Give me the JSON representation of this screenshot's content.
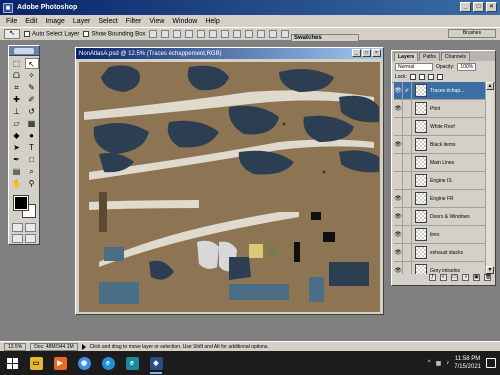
{
  "app": {
    "title": "Adobe Photoshop",
    "icon_name": "photoshop-icon",
    "window_controls": [
      "minimize",
      "maximize",
      "close"
    ]
  },
  "menu": [
    "File",
    "Edit",
    "Image",
    "Layer",
    "Select",
    "Filter",
    "View",
    "Window",
    "Help"
  ],
  "options": {
    "auto_select": "Auto Select Layer",
    "show_bounding": "Show Bounding Box"
  },
  "palette_tabs": {
    "swatches": "Swatches",
    "brushes": "Brushes"
  },
  "document": {
    "title": "NonAtlasA.psd @ 12.5% (Traces échappement,RGB)",
    "canvas_bg": "#8b7355"
  },
  "layers_panel": {
    "tabs": [
      "Layers",
      "Paths",
      "Channels"
    ],
    "blend_mode": "Normal",
    "opacity_label": "Opacity:",
    "opacity_value": "100%",
    "lock_label": "Lock:",
    "items": [
      {
        "name": "Traces échap...",
        "visible": true,
        "selected": true
      },
      {
        "name": "Pitot",
        "visible": true,
        "selected": false
      },
      {
        "name": "White Roof",
        "visible": false,
        "selected": false
      },
      {
        "name": "Black items",
        "visible": true,
        "selected": false
      },
      {
        "name": "Main Lines",
        "visible": false,
        "selected": false
      },
      {
        "name": "Engine IS",
        "visible": false,
        "selected": false
      },
      {
        "name": "Engine FR",
        "visible": true,
        "selected": false
      },
      {
        "name": "Doors & Windows",
        "visible": true,
        "selected": false
      },
      {
        "name": "tires",
        "visible": true,
        "selected": false
      },
      {
        "name": "exhaust stacks",
        "visible": true,
        "selected": false
      },
      {
        "name": "Grey intrados",
        "visible": true,
        "selected": false
      }
    ]
  },
  "status": {
    "zoom": "12.5%",
    "doc_info": "Doc: 48M/344.1M",
    "hint": "Click and drag to move layer or selection. Use Shift and Alt for additional options."
  },
  "taskbar": {
    "time": "11:58 PM",
    "date": "7/15/2021",
    "apps": [
      {
        "icon": "file-explorer-icon",
        "color": "#e8b830",
        "glyph": "▭"
      },
      {
        "icon": "media-player-icon",
        "color": "#e86a20",
        "glyph": "▶"
      },
      {
        "icon": "chrome-icon",
        "color": "#3a8ee6",
        "glyph": "◉"
      },
      {
        "icon": "edge-icon",
        "color": "#1f8fd8",
        "glyph": "e"
      },
      {
        "icon": "store-icon",
        "color": "#1a8a9a",
        "glyph": "e"
      },
      {
        "icon": "photoshop-icon",
        "color": "#2d4a86",
        "glyph": "◈"
      }
    ]
  }
}
